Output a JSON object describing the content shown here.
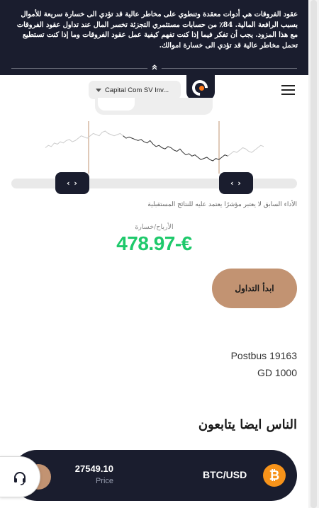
{
  "risk_warning": {
    "text": "عقود الفروقات هي أدوات معقدة وتنطوي على مخاطر عالية قد تؤدي الى خسارة سريعة للأموال بسبب الرافعة المالية. 84٪ من حسابات مستثمري التجزئة تخسر المال عند تداول عقود الفروقات مع هذا المزود. يجب أن تفكر فيما إذا كنت تفهم كيفية عمل عقود الفروقات وما إذا كنت تستطيع تحمل مخاطر عالية قد تؤدي الى خسارة اموالك.",
    "toggle_glyph": "»"
  },
  "header": {
    "entity_label": "Capital Com SV Inv..."
  },
  "chart_data": {
    "type": "line",
    "values": [
      50,
      52,
      51,
      54,
      53,
      55,
      54,
      56,
      57,
      55,
      56,
      58,
      60,
      59,
      58,
      60,
      62,
      61,
      60,
      63,
      64,
      62,
      61,
      60,
      61,
      62,
      60,
      58,
      59,
      58,
      57,
      56,
      57,
      55,
      54,
      56,
      53,
      51,
      52,
      50,
      49,
      51,
      50,
      48,
      47,
      49,
      46,
      44,
      45,
      43,
      44,
      42,
      40,
      41,
      42,
      40,
      39,
      41,
      40,
      42,
      44,
      43,
      45,
      47,
      46,
      48,
      50,
      49,
      47,
      46,
      48,
      50,
      52,
      51
    ],
    "selected_from_index": 26,
    "selected_to_index": 61
  },
  "slider": {
    "left_handle_glyph": "‹ ›",
    "right_handle_glyph": "‹ ›"
  },
  "disclaimer": "الأداء السابق لا يعتبر مؤشرًا يعتمد عليه للنتائج المستقبلية",
  "profit_loss": {
    "label": "الأرباح/خسارة",
    "value": "478.97-€"
  },
  "start_button_label": "ابدأ التداول",
  "address": {
    "line1": "Postbus 19163",
    "line2": "GD 1000"
  },
  "section_title": "الناس ايضا يتابعون",
  "ticker": {
    "pair": "BTC/USD",
    "coin_glyph": "₿",
    "price": "27549.10",
    "price_label": "Price"
  },
  "colors": {
    "dark": "#1a1d2e",
    "accent": "#c29372",
    "profit_green": "#1ec96b",
    "bitcoin": "#f7931a"
  }
}
